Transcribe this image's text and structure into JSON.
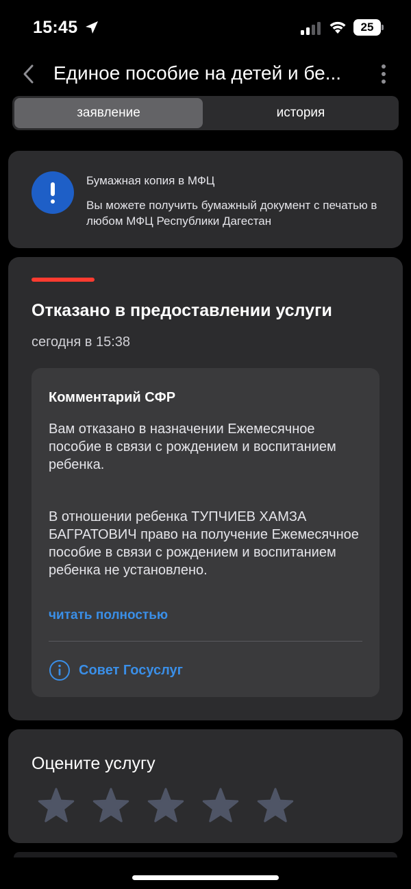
{
  "status_bar": {
    "time": "15:45",
    "battery": "25"
  },
  "header": {
    "title": "Единое пособие на детей и бе..."
  },
  "tabs": [
    {
      "label": "заявление",
      "active": true
    },
    {
      "label": "история",
      "active": false
    }
  ],
  "info_card": {
    "title": "Бумажная копия в МФЦ",
    "text": "Вы можете получить бумажный документ с печатью в любом МФЦ Республики Дагестан"
  },
  "status_card": {
    "status": "Отказано в предоставлении услуги",
    "time": "сегодня в 15:38",
    "comment": {
      "title": "Комментарий СФР",
      "paragraph1": "Вам отказано в назначении Ежемесячное пособие в связи с рождением и воспитанием ребенка.",
      "paragraph2": "В отношении ребенка ТУПЧИЕВ ХАМЗА БАГРАТОВИЧ право на получение Ежемесячное пособие в связи с рождением и воспитанием ребенка не установлено.",
      "read_more": "читать полностью",
      "advice": "Совет Госуслуг"
    }
  },
  "rating": {
    "title": "Оцените услугу",
    "stars_total": 5,
    "stars_selected": 0
  },
  "colors": {
    "background": "#000000",
    "card": "#2c2c2e",
    "accent_blue": "#3a8fe8",
    "info_icon": "#1e5fc7",
    "status_red": "#ff3b30",
    "star_inactive": "#4f5566"
  }
}
